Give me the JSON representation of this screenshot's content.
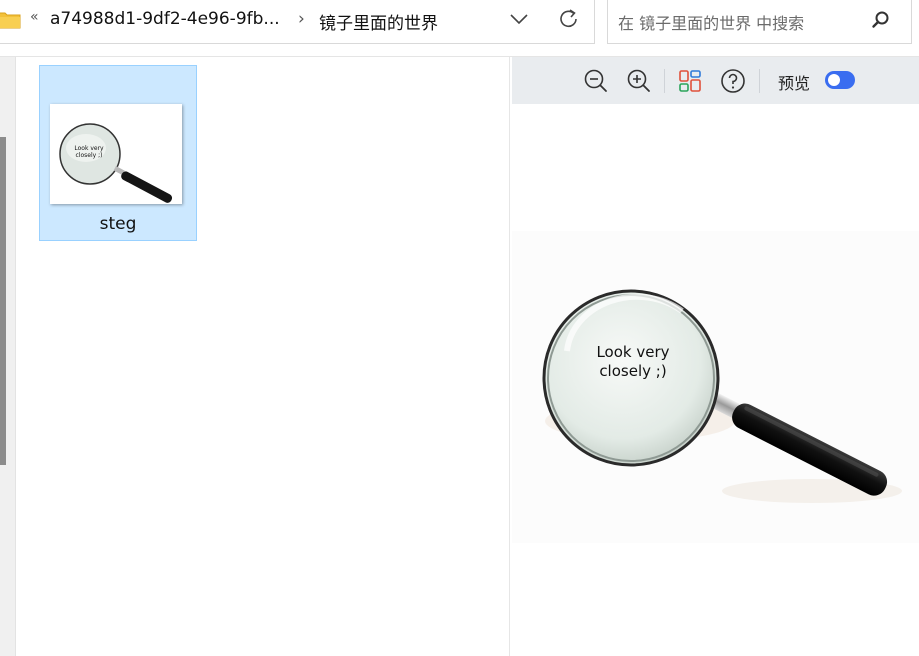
{
  "address_bar": {
    "overflow_chevron": "«",
    "path": [
      "a74988d1-9df2-4e96-9fb...",
      "镜子里面的世界"
    ],
    "separator": "›",
    "dropdown_icon": "chevron-down-icon",
    "refresh_icon": "refresh-icon"
  },
  "search": {
    "placeholder": "在 镜子里面的世界 中搜索",
    "icon": "search-icon"
  },
  "files": [
    {
      "name": "steg",
      "thumbnail_text": [
        "Look very",
        "closely ;)"
      ]
    }
  ],
  "preview": {
    "toolbar": {
      "zoom_out_icon": "zoom-out-icon",
      "zoom_in_icon": "zoom-in-icon",
      "layout_icon": "apps-icon",
      "help_icon": "help-icon",
      "label": "预览",
      "toggle_on": true
    },
    "image_text": [
      "Look very",
      "closely ;)"
    ]
  },
  "colors": {
    "selection_bg": "#cce8ff",
    "selection_border": "#99d1ff",
    "toggle": "#3a6df0",
    "toolbar_bg": "#e9ecef",
    "folder": "#f3c13a"
  }
}
